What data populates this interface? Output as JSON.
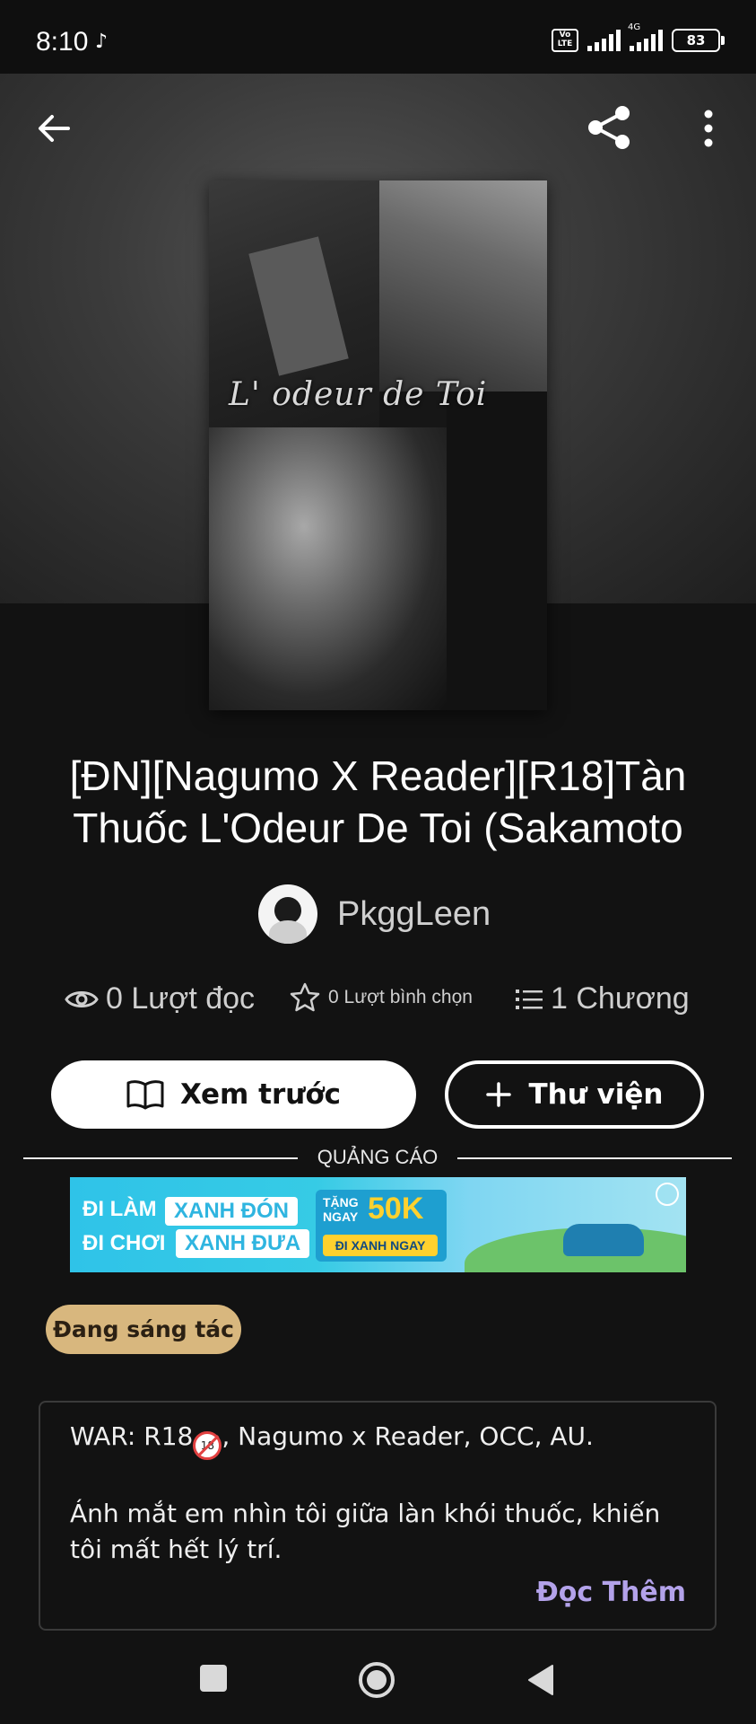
{
  "status_bar": {
    "time": "8:10",
    "volte": "Vo LTE",
    "network": "4G",
    "battery": "83"
  },
  "header": {
    "back_icon": "arrow-left-icon",
    "share_icon": "share-icon",
    "more_icon": "more-vertical-icon"
  },
  "cover": {
    "title_text": "L' odeur de Toi"
  },
  "book": {
    "title_line1": "[ĐN][Nagumo X Reader][R18]Tàn",
    "title_line2": "Thuốc L'Odeur De Toi (Sakamoto",
    "author": "PkggLeen"
  },
  "stats": {
    "reads": "0 Lượt đọc",
    "votes": "0 Lượt bình chọn",
    "chapters": "1 Chương"
  },
  "actions": {
    "preview_label": "Xem trước",
    "library_label": "Thư viện"
  },
  "ad": {
    "label": "QUẢNG CÁO",
    "line1_a": "ĐI LÀM",
    "line1_b": "XANH ĐÓN",
    "line2_a": "ĐI CHƠI",
    "line2_b": "XANH ĐƯA",
    "offer_small": "TẶNG NGAY",
    "offer_big": "50K",
    "cta": "ĐI XANH NGAY"
  },
  "status_chip": "Đang sáng tác",
  "description": {
    "line1_a": "WAR: R18",
    "line1_b": ", Nagumo x Reader, OCC, AU.",
    "line2": "Ánh mắt em nhìn tôi giữa làn khói thuốc, khiến",
    "line3": "tôi mất hết lý trí.",
    "read_more": "Đọc Thêm"
  },
  "colors": {
    "background": "#121212",
    "chip": "#d8b77e",
    "read_more": "#b3a2ea"
  }
}
